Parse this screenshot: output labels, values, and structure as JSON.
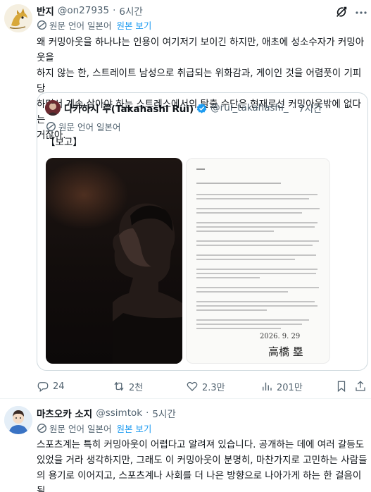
{
  "tweet1": {
    "name": "반지",
    "handle": "@on27935",
    "sep": "·",
    "time": "6시간",
    "translation": {
      "label": "원문 언어 일본어",
      "view": "원본 보기"
    },
    "text": "왜 커밍아웃을 하나냐는 인용이 여기저기 보이긴 하지만, 애초에 성소수자가 커밍아웃을\n하지 않는 한, 스트레이트 남성으로 취급되는 위화감과, 게이인 것을 어렴풋이 기피당\n하면서 계속 살아야 하는 스트레스에서의 탈출 수단은 현재로선 커밍아웃밖에 없다는\n거잖아.",
    "quote": {
      "name": "다카하시 루(Takahashi Rui)",
      "handle": "@rui_takahashi_",
      "sep": "·",
      "time": "7시간",
      "translation": {
        "label": "원문 언어 일본어"
      },
      "text": "【보고】",
      "letter": {
        "date": "2026. 9. 29",
        "signature": "高橋 塁"
      }
    },
    "actions": {
      "reply": "24",
      "retweet": "2천",
      "like": "2.3만",
      "views": "201만"
    }
  },
  "tweet2": {
    "name": "마츠오카 소지",
    "handle": "@ssimtok",
    "sep": "·",
    "time": "5시간",
    "translation": {
      "label": "원문 언어 일본어",
      "view": "원본 보기"
    },
    "text": "스포츠계는 특히 커밍아웃이 어렵다고 알려져 있습니다. 공개하는 데에 여러 갈등도\n있었을 거라 생각하지만, 그래도 이 커밍아웃이 분명히, 마찬가지로 고민하는 사람들\n의 용기로 이어지고, 스포츠계나 사회를 더 나은 방향으로 나아가게 하는 한 걸음이 될\n거라 믿습니다. 진심으로 응원합니다."
  },
  "colors": {
    "text": "#0f1419",
    "secondary": "#536471",
    "link": "#1d9bf0",
    "border": "#cfd9de",
    "verified": "#1d9bf0"
  },
  "icons": [
    "grok-icon",
    "translate-icon",
    "verified-badge-icon",
    "reply-icon",
    "retweet-icon",
    "like-icon",
    "views-icon",
    "bookmark-icon",
    "share-icon"
  ]
}
